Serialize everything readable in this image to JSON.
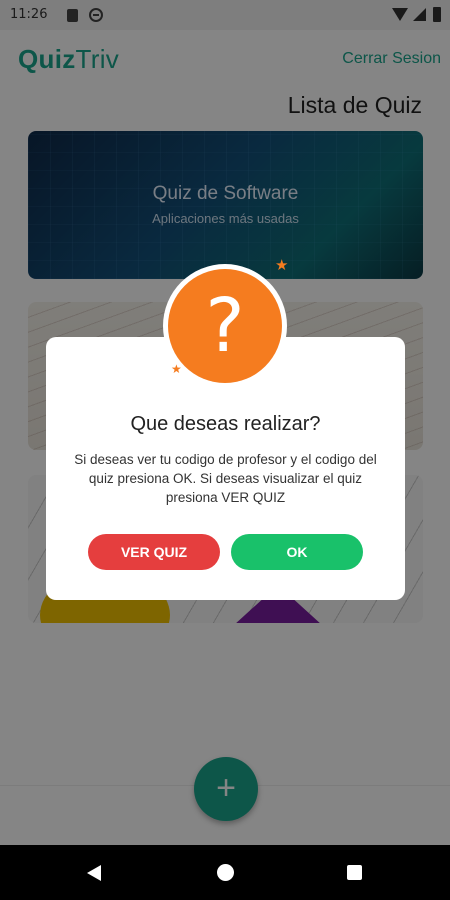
{
  "status_bar": {
    "time": "11:26"
  },
  "app_bar": {
    "logo_part1": "Quiz",
    "logo_part2": "Triv",
    "logout_label": "Cerrar Sesion"
  },
  "list_title": "Lista de Quiz",
  "cards": [
    {
      "title": "Quiz de Software",
      "subtitle": "Aplicaciones más usadas"
    }
  ],
  "fab": {
    "icon": "+"
  },
  "dialog": {
    "icon": "?",
    "title": "Que deseas realizar?",
    "message": "Si deseas ver tu codigo de profesor y el codigo del quiz presiona OK. Si deseas visualizar el quiz presiona VER QUIZ",
    "view_button": "VER QUIZ",
    "ok_button": "OK"
  },
  "colors": {
    "accent": "#1aa58c",
    "danger": "#e53e3e",
    "success": "#19c16a",
    "badge": "#f57c1f"
  },
  "icons": {
    "status": [
      "sd-card-icon",
      "do-not-disturb-icon",
      "wifi-icon",
      "signal-icon",
      "battery-icon"
    ],
    "nav": [
      "back-icon",
      "home-icon",
      "recents-icon"
    ]
  }
}
